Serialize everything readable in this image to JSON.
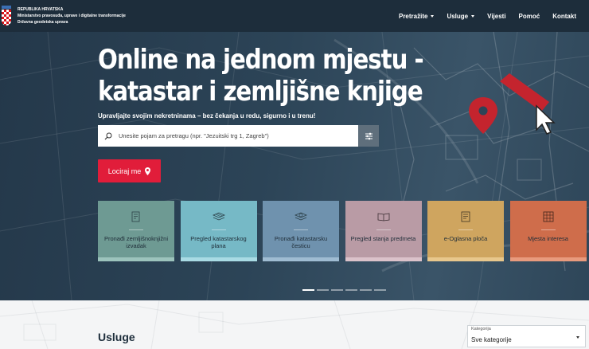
{
  "header": {
    "org_lines": [
      "REPUBLIKA HRVATSKA",
      "Ministarstvo pravosuđa, uprave i digitalne transformacije",
      "Državna geodetska uprava"
    ],
    "nav": [
      {
        "label": "Pretražite",
        "dropdown": true
      },
      {
        "label": "Usluge",
        "dropdown": true
      },
      {
        "label": "Vijesti",
        "dropdown": false
      },
      {
        "label": "Pomoć",
        "dropdown": false
      },
      {
        "label": "Kontakt",
        "dropdown": false
      }
    ]
  },
  "hero": {
    "title": "Online na jednom mjestu - katastar i zemljišne knjige",
    "subtitle": "Upravljajte svojim nekretninama – bez čekanja u redu, sigurno i u trenu!",
    "search_placeholder": "Unesite pojam za pretragu (npr. \"Jezuitski trg 1, Zagreb\")",
    "search_icon": "search-icon",
    "filter_icon": "sliders-icon",
    "locate_label": "Lociraj me",
    "locate_icon": "map-pin-icon"
  },
  "cards": [
    {
      "label": "Pronađi zemljišnoknjižni izvadak",
      "icon": "document-icon",
      "bg": "#6e9a93",
      "bar": "#9cc3bc"
    },
    {
      "label": "Pregled katastarskog plana",
      "icon": "map-layers-icon",
      "bg": "#76b9c6",
      "bar": "#a9dbe4"
    },
    {
      "label": "Pronađi katastarsku česticu",
      "icon": "parcel-search-icon",
      "bg": "#6f92ae",
      "bar": "#9fbcd2"
    },
    {
      "label": "Pregled stanja predmeta",
      "icon": "book-icon",
      "bg": "#b99ba5",
      "bar": "#dbc2ca"
    },
    {
      "label": "e-Oglasna ploča",
      "icon": "notice-board-icon",
      "bg": "#cfa55f",
      "bar": "#e8c78c"
    },
    {
      "label": "Mjesta interesa",
      "icon": "grid-icon",
      "bg": "#cf6d4b",
      "bar": "#e89a7d"
    }
  ],
  "carousel": {
    "count": 6,
    "active": 0
  },
  "services": {
    "title": "Usluge",
    "category_label": "Kategorija",
    "category_value": "Sve kategorije"
  },
  "colors": {
    "navbar": "#1d2d3b",
    "accent": "#e11d3a"
  }
}
